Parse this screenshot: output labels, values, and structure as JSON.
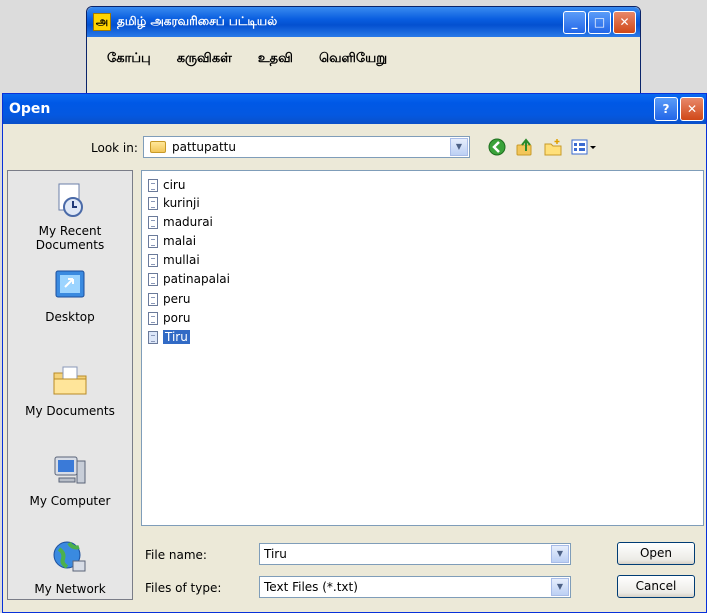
{
  "app_window": {
    "icon_letter": "அ",
    "title": "தமிழ் அகரவரிசைப் பட்டியல்",
    "menu": [
      "கோப்பு",
      "கருவிகள்",
      "உதவி",
      "வெளியேறு"
    ]
  },
  "dialog": {
    "title": "Open",
    "help_glyph": "?",
    "close_glyph": "✕",
    "look_in_label": "Look in:",
    "look_in_value": "pattupattu",
    "places": [
      "My Recent Documents",
      "Desktop",
      "My Documents",
      "My Computer",
      "My Network"
    ],
    "files": [
      "ciru",
      "kurinji",
      "madurai",
      "malai",
      "mullai",
      "patinapalai",
      "peru",
      "poru",
      "Tiru"
    ],
    "selected_file": "Tiru",
    "file_name_label": "File name:",
    "file_name_value": "Tiru",
    "file_type_label": "Files of type:",
    "file_type_value": "Text Files (*.txt)",
    "open_button": "Open",
    "cancel_button": "Cancel"
  },
  "colors": {
    "xp_blue": "#0058e6",
    "selection": "#316ac5",
    "dialog_bg": "#ece9d8"
  }
}
